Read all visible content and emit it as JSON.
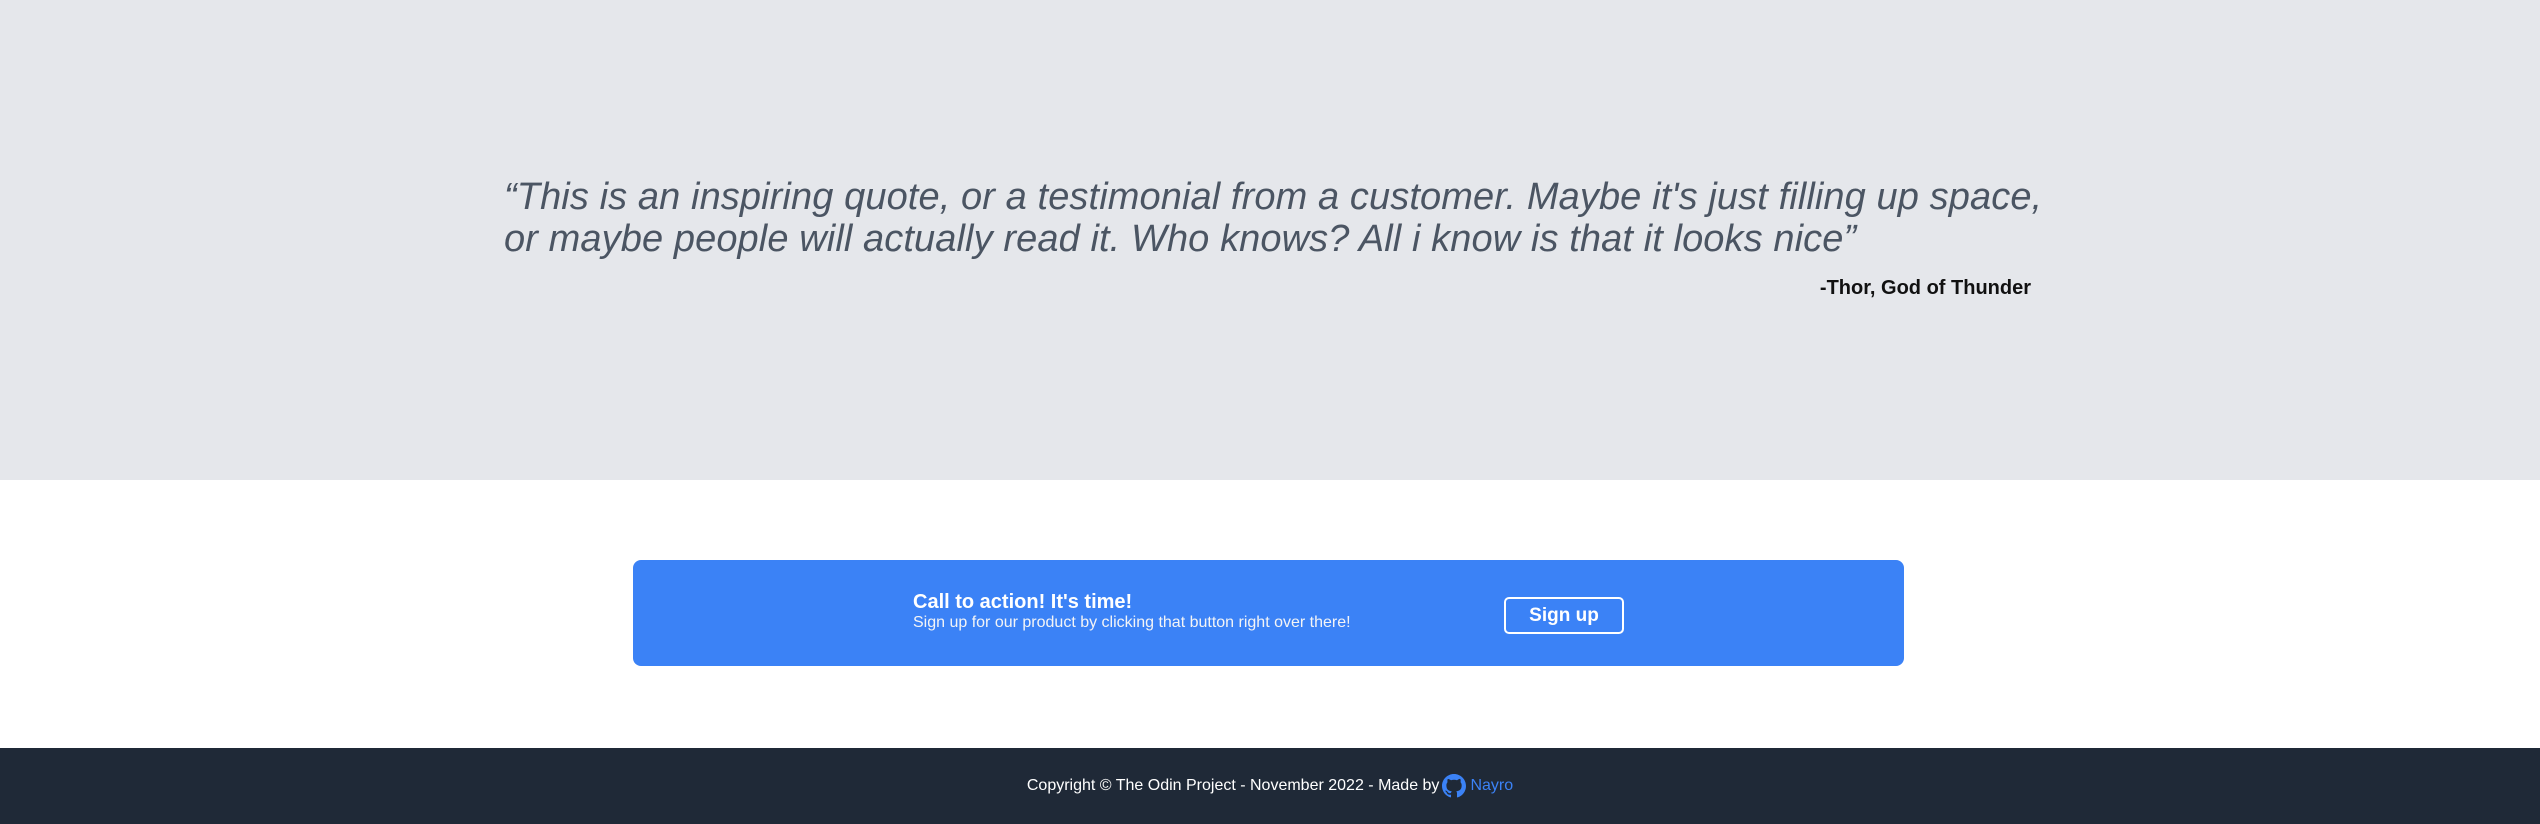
{
  "quote": {
    "text": "“This is an inspiring quote, or a testimonial from a customer. Maybe it's just filling up space, or maybe people will actually read it. Who knows? All i know is that it looks nice”",
    "author": "-Thor, God of Thunder"
  },
  "cta": {
    "title": "Call to action! It's time!",
    "subtitle": "Sign up for our product by clicking that button right over there!",
    "button_label": "Sign up"
  },
  "footer": {
    "copyright": "Copyright © The Odin Project - November 2022 - Made by",
    "author_link": "Nayro",
    "icon": "github-icon"
  },
  "colors": {
    "quote_bg": "#e5e7eb",
    "accent": "#3b82f6",
    "footer_bg": "#1f2937"
  }
}
